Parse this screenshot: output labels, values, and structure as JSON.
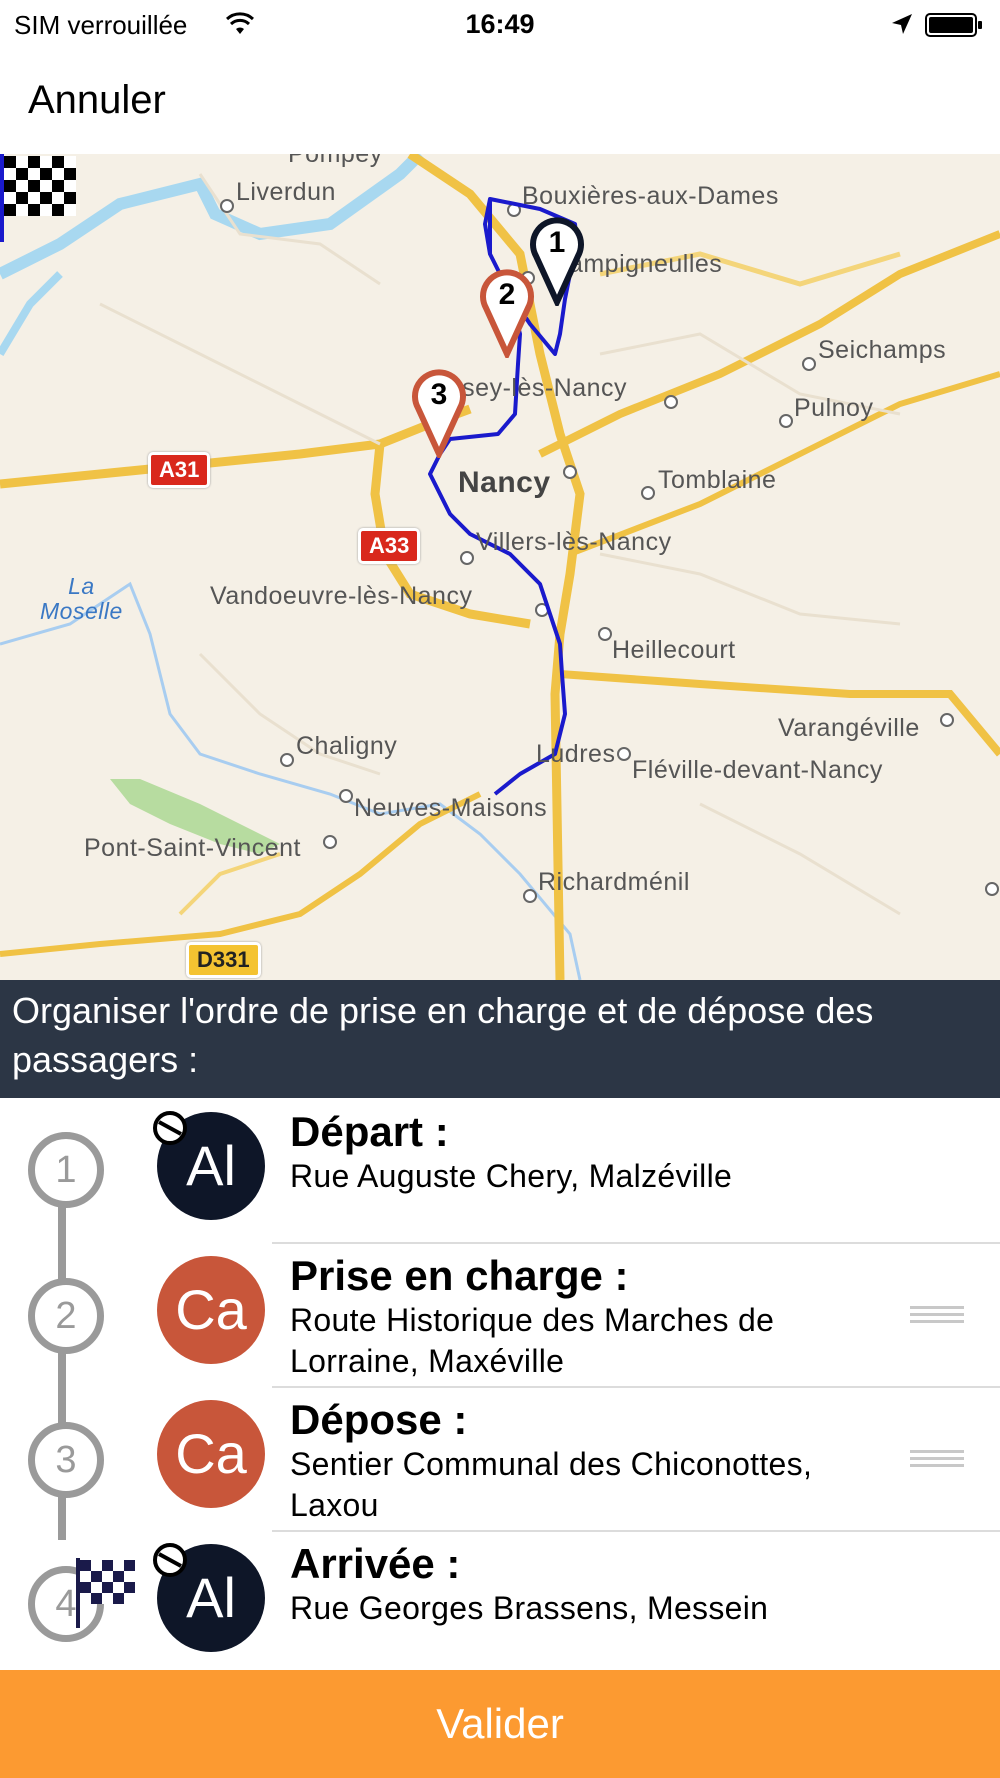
{
  "status_bar": {
    "carrier": "SIM verrouillée",
    "time": "16:49",
    "icons": [
      "wifi-icon",
      "location-arrow-icon",
      "battery-icon"
    ]
  },
  "nav": {
    "cancel_label": "Annuler"
  },
  "map": {
    "places": {
      "pompey": "Pompey",
      "liverdun": "Liverdun",
      "bouxieres": "Bouxières-aux-Dames",
      "champigneulles": "Champigneulles",
      "seichamps": "Seichamps",
      "essey": "Essey-lès-Nancy",
      "pulnoy": "Pulnoy",
      "nancy": "Nancy",
      "tomblaine": "Tomblaine",
      "villers": "Villers-lès-Nancy",
      "vandoeuvre": "Vandoeuvre-lès-Nancy",
      "moselle": "La\nMoselle",
      "heillecourt": "Heillecourt",
      "varangeville": "Varangéville",
      "chaligny": "Chaligny",
      "ludres": "Ludres",
      "fleville": "Fléville-devant-Nancy",
      "neuves": "Neuves-Maisons",
      "pont": "Pont-Saint-Vincent",
      "richardmenil": "Richardménil"
    },
    "roads": {
      "a31": "A31",
      "a33": "A33",
      "d331": "D331"
    },
    "pins": {
      "p1": "1",
      "p2": "2",
      "p3": "3"
    },
    "colors": {
      "route": "#1a1acc",
      "pin_dark": "#0e1628",
      "pin_red": "#c8563a"
    }
  },
  "banner": {
    "text": "Organiser l'ordre de prise en charge et de dépose des passagers :"
  },
  "stops": [
    {
      "step": "1",
      "initials": "Al",
      "title": "Départ :",
      "address": "Rue Auguste Chery, Malzéville",
      "color": "#0e1628"
    },
    {
      "step": "2",
      "initials": "Ca",
      "title": "Prise en charge :",
      "address": "Route Historique des Marches de Lorraine, Maxéville",
      "color": "#c8563a"
    },
    {
      "step": "3",
      "initials": "Ca",
      "title": "Dépose :",
      "address": "Sentier Communal des Chiconottes, Laxou",
      "color": "#c8563a"
    },
    {
      "step": "4",
      "initials": "Al",
      "title": "Arrivée :",
      "address": "Rue Georges Brassens, Messein",
      "color": "#0e1628"
    }
  ],
  "footer": {
    "validate_label": "Valider",
    "color": "#fc9a31"
  }
}
